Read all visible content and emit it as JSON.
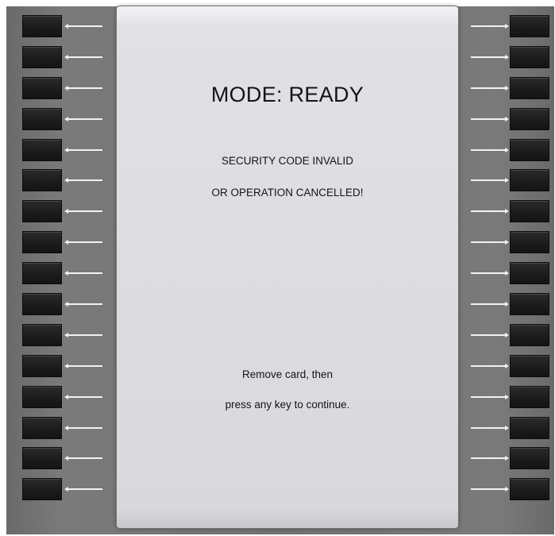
{
  "screen": {
    "mode_title": "MODE: READY",
    "message_line1": "SECURITY CODE INVALID",
    "message_line2": "OR OPERATION CANCELLED!",
    "prompt_line1": "Remove card, then",
    "prompt_line2": "press any key to continue."
  },
  "left_keys": [
    {
      "icon": "arrow-left-icon"
    },
    {
      "icon": "arrow-left-icon"
    },
    {
      "icon": "arrow-left-icon"
    },
    {
      "icon": "arrow-left-icon"
    },
    {
      "icon": "arrow-left-icon"
    },
    {
      "icon": "arrow-left-icon"
    },
    {
      "icon": "arrow-left-icon"
    },
    {
      "icon": "arrow-left-icon"
    },
    {
      "icon": "arrow-left-icon"
    },
    {
      "icon": "arrow-left-icon"
    },
    {
      "icon": "arrow-left-icon"
    },
    {
      "icon": "arrow-left-icon"
    },
    {
      "icon": "arrow-left-icon"
    },
    {
      "icon": "arrow-left-icon"
    },
    {
      "icon": "arrow-left-icon"
    },
    {
      "icon": "arrow-left-icon"
    }
  ],
  "right_keys": [
    {
      "icon": "arrow-right-icon"
    },
    {
      "icon": "arrow-right-icon"
    },
    {
      "icon": "arrow-right-icon"
    },
    {
      "icon": "arrow-right-icon"
    },
    {
      "icon": "arrow-right-icon"
    },
    {
      "icon": "arrow-right-icon"
    },
    {
      "icon": "arrow-right-icon"
    },
    {
      "icon": "arrow-right-icon"
    },
    {
      "icon": "arrow-right-icon"
    },
    {
      "icon": "arrow-right-icon"
    },
    {
      "icon": "arrow-right-icon"
    },
    {
      "icon": "arrow-right-icon"
    },
    {
      "icon": "arrow-right-icon"
    },
    {
      "icon": "arrow-right-icon"
    },
    {
      "icon": "arrow-right-icon"
    },
    {
      "icon": "arrow-right-icon"
    }
  ],
  "colors": {
    "bezel": "#727272",
    "key": "#1b1b1b",
    "arrow": "#f2f2f2",
    "screen": "#dddde1",
    "text": "#141414"
  }
}
